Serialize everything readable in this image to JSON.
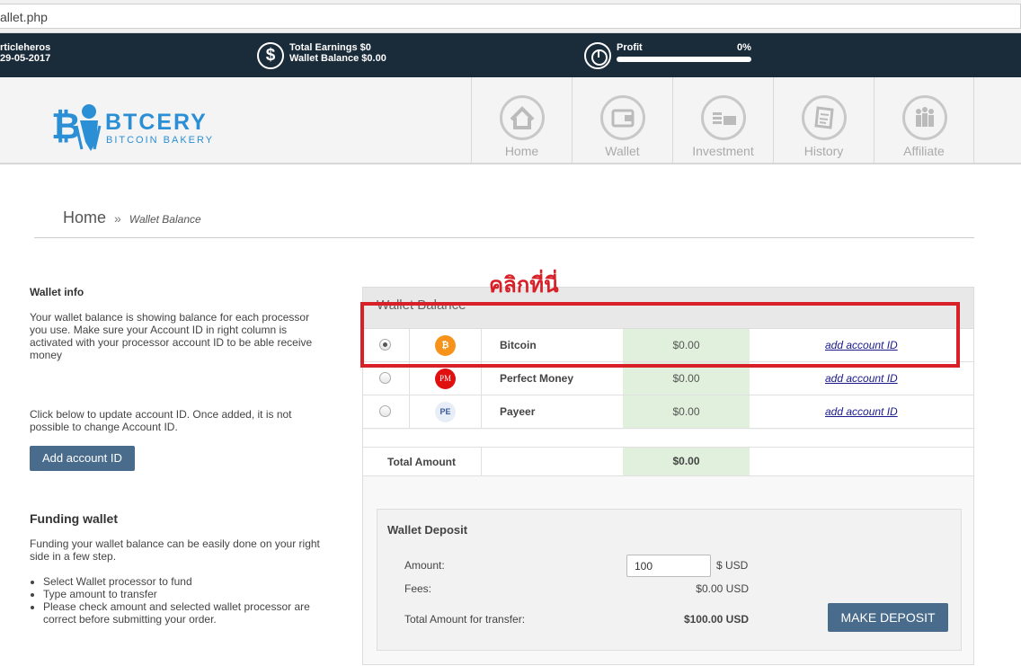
{
  "browser": {
    "url": "allet.php"
  },
  "topbar": {
    "username": "rticleheros",
    "date": "29-05-2017",
    "total_earnings": "Total Earnings $0",
    "wallet_balance": "Wallet Balance $0.00",
    "profit_label": "Profit",
    "profit_pct": "0%",
    "profit_value": 0
  },
  "logo": {
    "brand": "BTCERY",
    "tagline": "BITCOIN BAKERY"
  },
  "nav": {
    "items": [
      {
        "label": "Home",
        "icon": "home-icon"
      },
      {
        "label": "Wallet",
        "icon": "wallet-icon"
      },
      {
        "label": "Investment",
        "icon": "investment-icon"
      },
      {
        "label": "History",
        "icon": "history-icon"
      },
      {
        "label": "Affiliate",
        "icon": "affiliate-icon"
      }
    ]
  },
  "breadcrumb": {
    "home": "Home",
    "sep": "»",
    "current": "Wallet Balance"
  },
  "left": {
    "wallet_info_title": "Wallet info",
    "wallet_info_text": "Your wallet balance is showing balance for each processor you use. Make sure your Account ID in right column is activated with your processor account ID to be able receive money",
    "update_text": "Click below to update account ID. Once added, it is not possible to change Account ID.",
    "add_button": "Add account ID",
    "funding_title": "Funding wallet",
    "funding_text": "Funding your wallet balance can be easily done on your right side in a few step.",
    "steps": [
      "Select Wallet processor to fund",
      "Type amount to transfer",
      "Please check amount and selected wallet processor are correct before submitting your order."
    ]
  },
  "wallet": {
    "title": "Wallet Balance",
    "rows": [
      {
        "name": "Bitcoin",
        "amount": "$0.00",
        "link": "add account ID",
        "icon_text": "₿",
        "color": "#f7931a",
        "checked": true
      },
      {
        "name": "Perfect Money",
        "amount": "$0.00",
        "link": "add account ID",
        "icon_text": "PM",
        "color": "#e01010",
        "checked": false
      },
      {
        "name": "Payeer",
        "amount": "$0.00",
        "link": "add account ID",
        "icon_text": "PE",
        "color": "#e8eef8",
        "checked": false
      }
    ],
    "total_label": "Total Amount",
    "total_amount": "$0.00"
  },
  "deposit": {
    "title": "Wallet Deposit",
    "amount_label": "Amount:",
    "amount_value": "100",
    "unit": "$ USD",
    "fees_label": "Fees:",
    "fees_value": "$0.00 USD",
    "total_label": "Total Amount for transfer:",
    "total_value": "$100.00 USD",
    "button": "MAKE DEPOSIT"
  },
  "annotation": {
    "text": "คลิกที่นี่",
    "color": "#d72027"
  }
}
